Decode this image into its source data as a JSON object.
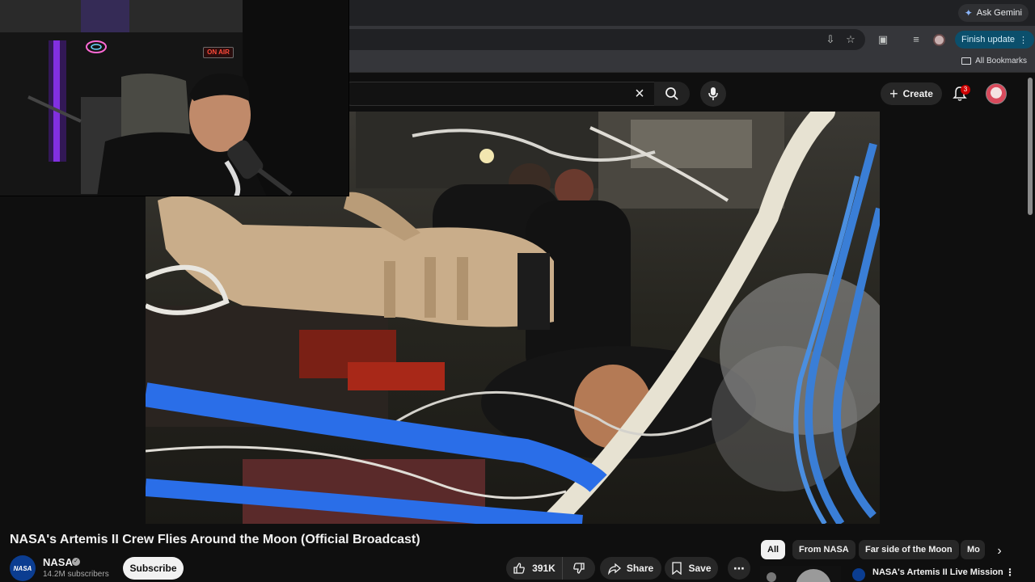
{
  "browser": {
    "ask_gemini_label": "Ask Gemini",
    "finish_update_label": "Finish update",
    "all_bookmarks_label": "All Bookmarks"
  },
  "youtube": {
    "create_label": "Create",
    "notification_count": "3"
  },
  "webcam": {
    "on_air_sign": "ON AIR"
  },
  "video": {
    "title": "NASA's Artemis II Crew Flies Around the Moon (Official Broadcast)",
    "channel_name": "NASA",
    "channel_logo_text": "NASA",
    "subscribers": "14.2M subscribers",
    "subscribe_label": "Subscribe",
    "likes": "391K",
    "share_label": "Share",
    "save_label": "Save"
  },
  "chips": [
    {
      "label": "All",
      "active": true
    },
    {
      "label": "From NASA",
      "active": false
    },
    {
      "label": "Far side of the Moon",
      "active": false
    },
    {
      "label": "Mo",
      "active": false
    }
  ],
  "recommendation": {
    "title": "NASA's Artemis II Live Mission"
  },
  "colors": {
    "background": "#0f0f0f",
    "finish_update_bg": "#0b4f6c",
    "notification_badge": "#cc0000"
  }
}
